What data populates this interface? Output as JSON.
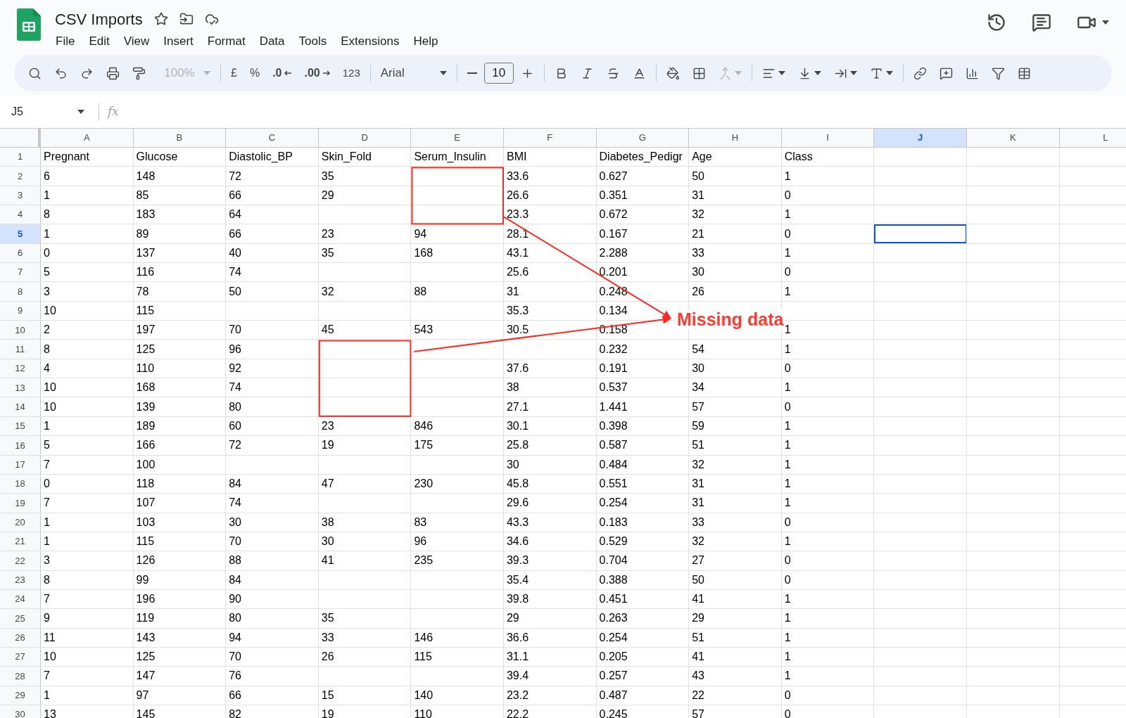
{
  "document": {
    "title": "CSV Imports"
  },
  "menu": [
    "File",
    "Edit",
    "View",
    "Insert",
    "Format",
    "Data",
    "Tools",
    "Extensions",
    "Help"
  ],
  "toolbar": {
    "zoom": "100%",
    "currency": "£",
    "percent": "%",
    "decrease_decimals": ".0",
    "increase_decimals": ".00",
    "number_format": "123",
    "font": "Arial",
    "font_size": "10"
  },
  "name_box": "J5",
  "formula_label": "fx",
  "columns": [
    {
      "label": "A",
      "selected": false
    },
    {
      "label": "B",
      "selected": false
    },
    {
      "label": "C",
      "selected": false
    },
    {
      "label": "D",
      "selected": false
    },
    {
      "label": "E",
      "selected": false
    },
    {
      "label": "F",
      "selected": false
    },
    {
      "label": "G",
      "selected": false
    },
    {
      "label": "H",
      "selected": false
    },
    {
      "label": "I",
      "selected": false
    },
    {
      "label": "J",
      "selected": true
    },
    {
      "label": "K",
      "selected": false
    },
    {
      "label": "L",
      "selected": false
    }
  ],
  "rows": [
    {
      "number": "1",
      "selected": false,
      "cells": [
        "Pregnant",
        "Glucose",
        "Diastolic_BP",
        "Skin_Fold",
        "Serum_Insulin",
        "BMI",
        "Diabetes_Pedigr",
        "Age",
        "Class"
      ]
    },
    {
      "number": "2",
      "selected": false,
      "cells": [
        "6",
        "148",
        "72",
        "35",
        null,
        "33.6",
        "0.627",
        "50",
        "1"
      ]
    },
    {
      "number": "3",
      "selected": false,
      "cells": [
        "1",
        "85",
        "66",
        "29",
        null,
        "26.6",
        "0.351",
        "31",
        "0"
      ]
    },
    {
      "number": "4",
      "selected": false,
      "cells": [
        "8",
        "183",
        "64",
        null,
        null,
        "23.3",
        "0.672",
        "32",
        "1"
      ]
    },
    {
      "number": "5",
      "selected": true,
      "cells": [
        "1",
        "89",
        "66",
        "23",
        "94",
        "28.1",
        "0.167",
        "21",
        "0"
      ]
    },
    {
      "number": "6",
      "selected": false,
      "cells": [
        "0",
        "137",
        "40",
        "35",
        "168",
        "43.1",
        "2.288",
        "33",
        "1"
      ]
    },
    {
      "number": "7",
      "selected": false,
      "cells": [
        "5",
        "116",
        "74",
        null,
        null,
        "25.6",
        "0.201",
        "30",
        "0"
      ]
    },
    {
      "number": "8",
      "selected": false,
      "cells": [
        "3",
        "78",
        "50",
        "32",
        "88",
        "31",
        "0.248",
        "26",
        "1"
      ]
    },
    {
      "number": "9",
      "selected": false,
      "cells": [
        "10",
        "115",
        null,
        null,
        null,
        "35.3",
        "0.134",
        null,
        null
      ]
    },
    {
      "number": "10",
      "selected": false,
      "cells": [
        "2",
        "197",
        "70",
        "45",
        "543",
        "30.5",
        "0.158",
        null,
        "1"
      ]
    },
    {
      "number": "11",
      "selected": false,
      "cells": [
        "8",
        "125",
        "96",
        null,
        null,
        null,
        "0.232",
        "54",
        "1"
      ]
    },
    {
      "number": "12",
      "selected": false,
      "cells": [
        "4",
        "110",
        "92",
        null,
        null,
        "37.6",
        "0.191",
        "30",
        "0"
      ]
    },
    {
      "number": "13",
      "selected": false,
      "cells": [
        "10",
        "168",
        "74",
        null,
        null,
        "38",
        "0.537",
        "34",
        "1"
      ]
    },
    {
      "number": "14",
      "selected": false,
      "cells": [
        "10",
        "139",
        "80",
        null,
        null,
        "27.1",
        "1.441",
        "57",
        "0"
      ]
    },
    {
      "number": "15",
      "selected": false,
      "cells": [
        "1",
        "189",
        "60",
        "23",
        "846",
        "30.1",
        "0.398",
        "59",
        "1"
      ]
    },
    {
      "number": "16",
      "selected": false,
      "cells": [
        "5",
        "166",
        "72",
        "19",
        "175",
        "25.8",
        "0.587",
        "51",
        "1"
      ]
    },
    {
      "number": "17",
      "selected": false,
      "cells": [
        "7",
        "100",
        null,
        null,
        null,
        "30",
        "0.484",
        "32",
        "1"
      ]
    },
    {
      "number": "18",
      "selected": false,
      "cells": [
        "0",
        "118",
        "84",
        "47",
        "230",
        "45.8",
        "0.551",
        "31",
        "1"
      ]
    },
    {
      "number": "19",
      "selected": false,
      "cells": [
        "7",
        "107",
        "74",
        null,
        null,
        "29.6",
        "0.254",
        "31",
        "1"
      ]
    },
    {
      "number": "20",
      "selected": false,
      "cells": [
        "1",
        "103",
        "30",
        "38",
        "83",
        "43.3",
        "0.183",
        "33",
        "0"
      ]
    },
    {
      "number": "21",
      "selected": false,
      "cells": [
        "1",
        "115",
        "70",
        "30",
        "96",
        "34.6",
        "0.529",
        "32",
        "1"
      ]
    },
    {
      "number": "22",
      "selected": false,
      "cells": [
        "3",
        "126",
        "88",
        "41",
        "235",
        "39.3",
        "0.704",
        "27",
        "0"
      ]
    },
    {
      "number": "23",
      "selected": false,
      "cells": [
        "8",
        "99",
        "84",
        null,
        null,
        "35.4",
        "0.388",
        "50",
        "0"
      ]
    },
    {
      "number": "24",
      "selected": false,
      "cells": [
        "7",
        "196",
        "90",
        null,
        null,
        "39.8",
        "0.451",
        "41",
        "1"
      ]
    },
    {
      "number": "25",
      "selected": false,
      "cells": [
        "9",
        "119",
        "80",
        "35",
        null,
        "29",
        "0.263",
        "29",
        "1"
      ]
    },
    {
      "number": "26",
      "selected": false,
      "cells": [
        "11",
        "143",
        "94",
        "33",
        "146",
        "36.6",
        "0.254",
        "51",
        "1"
      ]
    },
    {
      "number": "27",
      "selected": false,
      "cells": [
        "10",
        "125",
        "70",
        "26",
        "115",
        "31.1",
        "0.205",
        "41",
        "1"
      ]
    },
    {
      "number": "28",
      "selected": false,
      "cells": [
        "7",
        "147",
        "76",
        null,
        null,
        "39.4",
        "0.257",
        "43",
        "1"
      ]
    },
    {
      "number": "29",
      "selected": false,
      "cells": [
        "1",
        "97",
        "66",
        "15",
        "140",
        "23.2",
        "0.487",
        "22",
        "0"
      ]
    },
    {
      "number": "30",
      "selected": false,
      "cells": [
        "13",
        "145",
        "82",
        "19",
        "110",
        "22.2",
        "0.245",
        "57",
        "0"
      ]
    }
  ],
  "annotation": {
    "label": "Missing data"
  }
}
